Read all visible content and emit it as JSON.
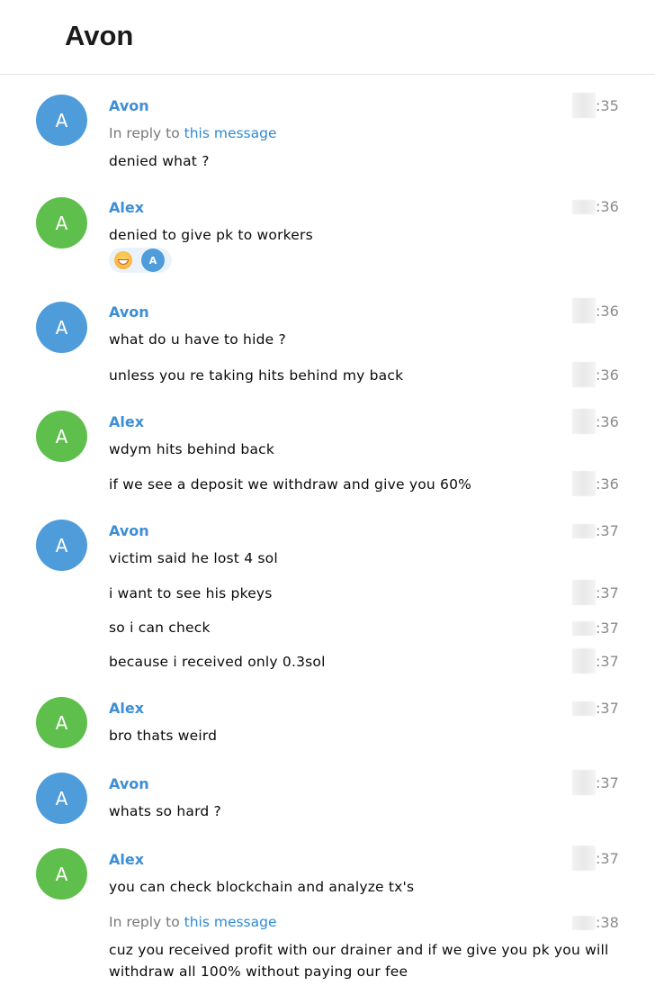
{
  "header": {
    "title": "Avon"
  },
  "messages": [
    {
      "initial": "A",
      "name": "Avon",
      "time": ":35",
      "reply_prefix": "In reply to",
      "reply_link": "this message",
      "text": "denied what ?"
    },
    {
      "initial": "A",
      "name": "Alex",
      "time": ":36",
      "text": "denied to give pk to workers",
      "reaction_avatar": "A"
    },
    {
      "initial": "A",
      "name": "Avon",
      "time": ":36",
      "text": "what do u have to hide ?"
    },
    {
      "time": ":36",
      "text": "unless you re taking hits behind my back"
    },
    {
      "initial": "A",
      "name": "Alex",
      "time": ":36",
      "text": "wdym hits behind back"
    },
    {
      "time": ":36",
      "text": "if we see a deposit we withdraw and give you 60%"
    },
    {
      "initial": "A",
      "name": "Avon",
      "time": ":37",
      "text": "victim said he lost 4 sol"
    },
    {
      "time": ":37",
      "text": "i want to see his pkeys"
    },
    {
      "time": ":37",
      "text": "so i can check"
    },
    {
      "time": ":37",
      "text": "because i received only 0.3sol"
    },
    {
      "initial": "A",
      "name": "Alex",
      "time": ":37",
      "text": "bro thats weird"
    },
    {
      "initial": "A",
      "name": "Avon",
      "time": ":37",
      "text": "whats so hard ?"
    },
    {
      "initial": "A",
      "name": "Alex",
      "time": ":37",
      "text": "you can check blockchain and analyze tx's"
    },
    {
      "time": ":38",
      "reply_prefix": "In reply to",
      "reply_link": "this message",
      "text_line1": "cuz you received profit with our drainer and if we give you pk you will",
      "text_line2": "withdraw all 100% without paying our fee"
    }
  ],
  "colors": {
    "avon_avatar": "#4f9cdb",
    "alex_avatar": "#5fbf4c",
    "name": "#3d8ed6",
    "link": "#2f8ad3"
  }
}
